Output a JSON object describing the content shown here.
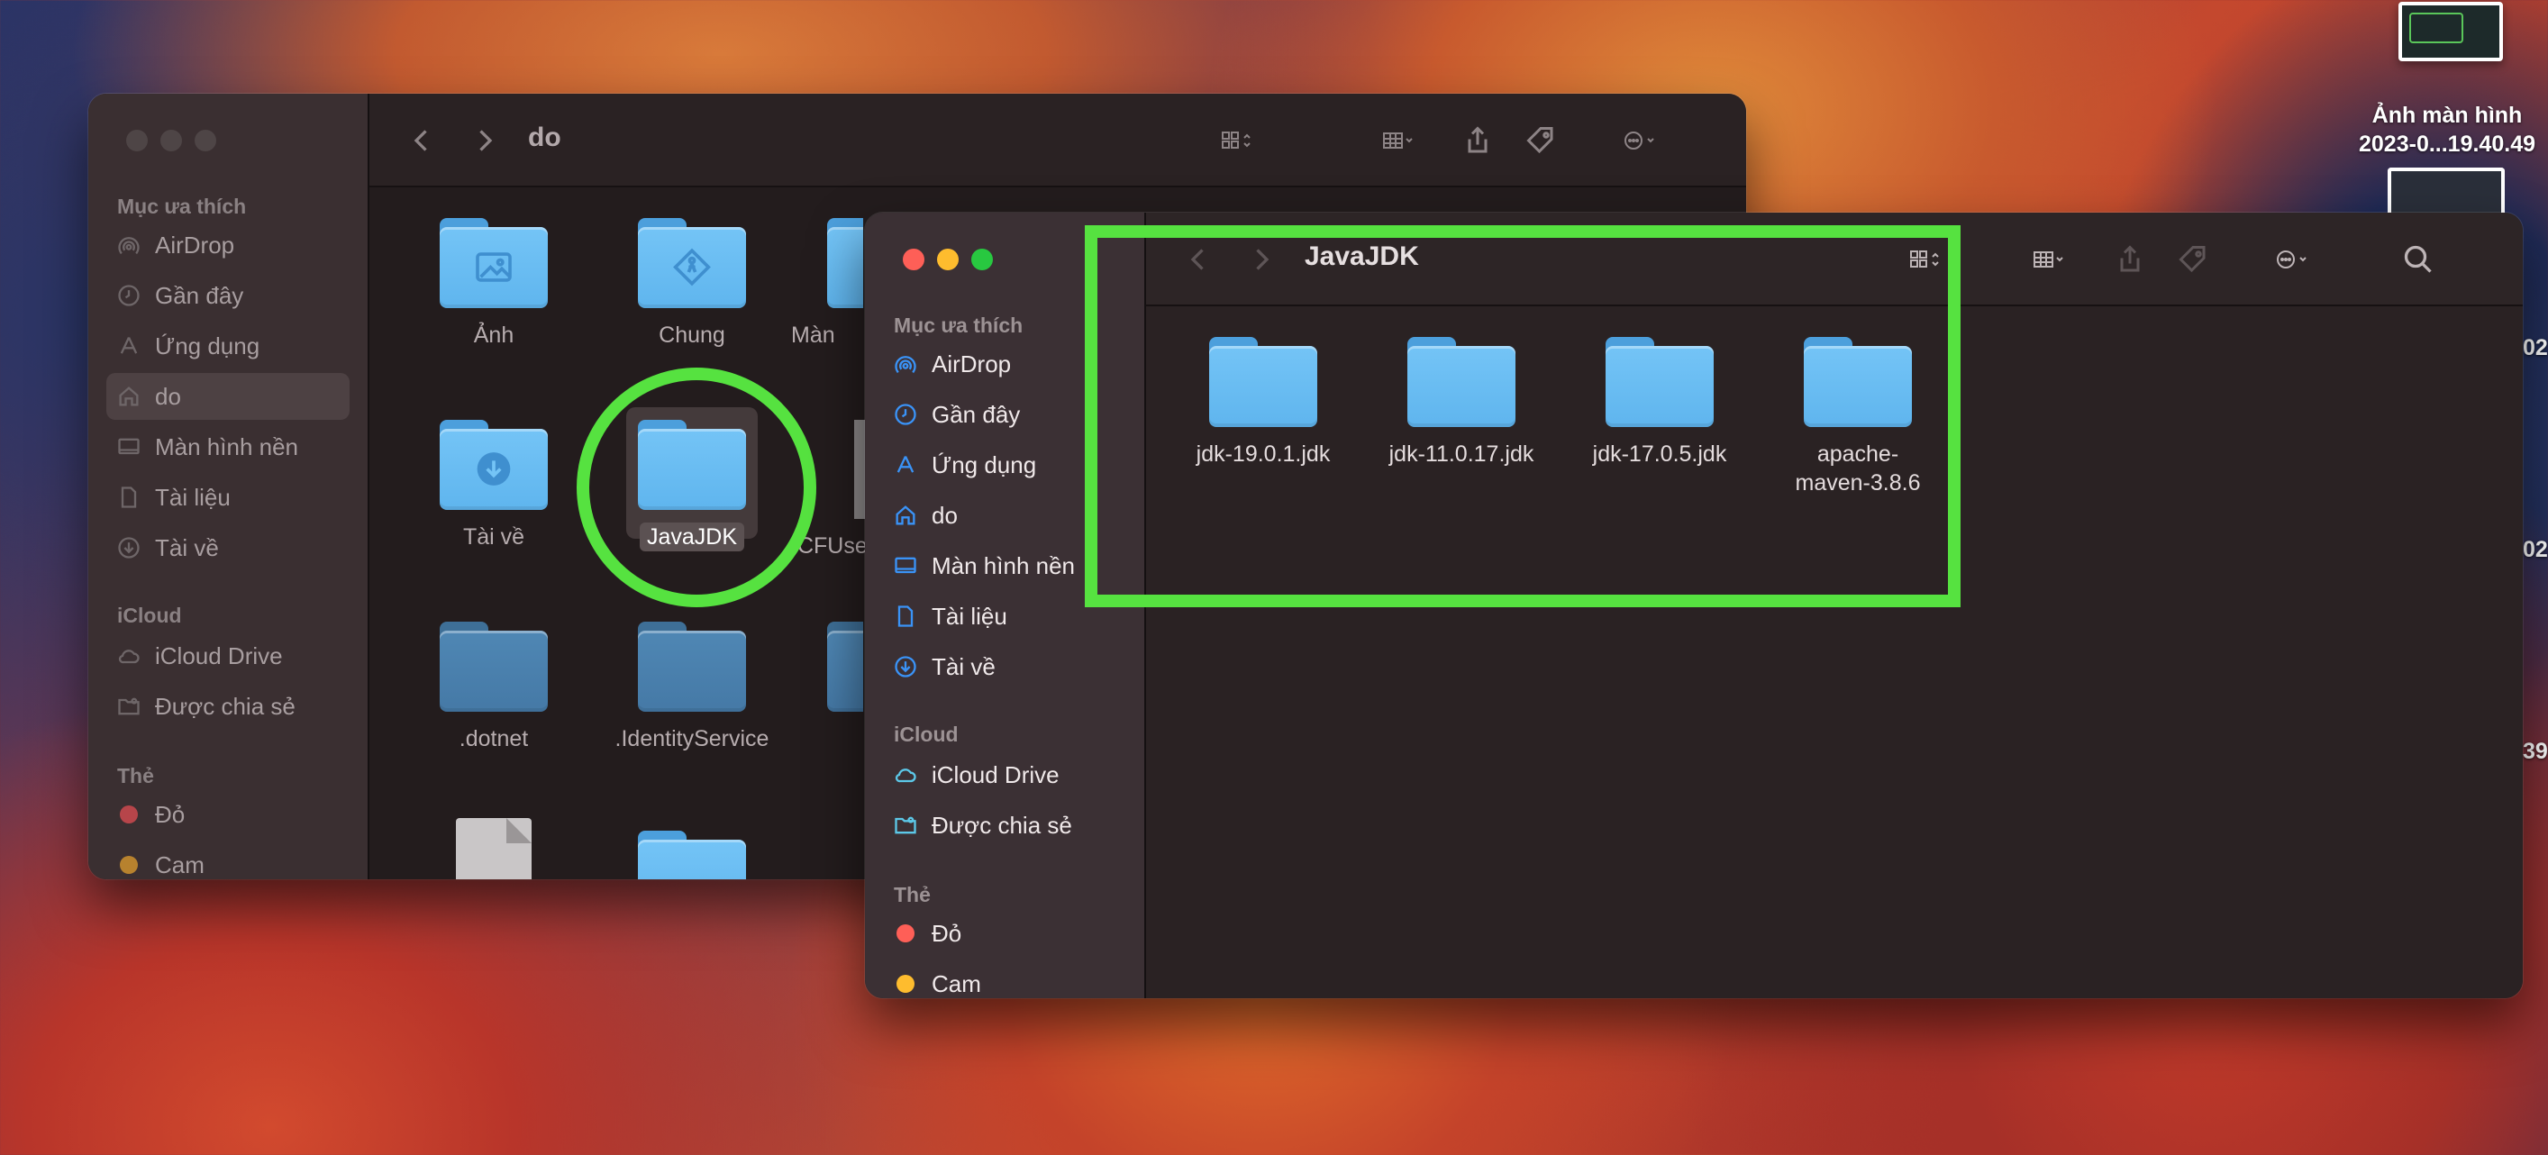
{
  "desktop": {
    "screenshot_label_line1": "Ảnh màn hình",
    "screenshot_label_line2": "2023-0...19.40.49",
    "edge_labels": [
      "02",
      "02",
      "39"
    ]
  },
  "back_window": {
    "title": "do",
    "sidebar": {
      "favorites_header": "Mục ưa thích",
      "favorites": [
        {
          "label": "AirDrop",
          "icon": "airdrop-icon"
        },
        {
          "label": "Gần đây",
          "icon": "clock-icon"
        },
        {
          "label": "Ứng dụng",
          "icon": "apps-icon"
        },
        {
          "label": "do",
          "icon": "home-icon",
          "selected": true
        },
        {
          "label": "Màn hình nền",
          "icon": "desktop-icon"
        },
        {
          "label": "Tài liệu",
          "icon": "document-icon"
        },
        {
          "label": "Tài về",
          "icon": "download-icon"
        }
      ],
      "icloud_header": "iCloud",
      "icloud": [
        {
          "label": "iCloud Drive",
          "icon": "cloud-icon"
        },
        {
          "label": "Được chia sẻ",
          "icon": "shared-folder-icon"
        }
      ],
      "tags_header": "Thẻ",
      "tags": [
        {
          "label": "Đỏ",
          "color": "#b7454a"
        },
        {
          "label": "Cam",
          "color": "#b7822e"
        }
      ]
    },
    "files": [
      {
        "name": "Ảnh"
      },
      {
        "name": "Chung"
      },
      {
        "name": "Màn"
      },
      {
        "name": "Tài về"
      },
      {
        "name": "JavaJDK"
      },
      {
        "name": ".CFUse"
      },
      {
        "name": ".dotnet"
      },
      {
        "name": ".IdentityService"
      },
      {
        "name": ""
      }
    ]
  },
  "front_window": {
    "title": "JavaJDK",
    "sidebar": {
      "favorites_header": "Mục ưa thích",
      "favorites": [
        {
          "label": "AirDrop",
          "icon": "airdrop-icon"
        },
        {
          "label": "Gần đây",
          "icon": "clock-icon"
        },
        {
          "label": "Ứng dụng",
          "icon": "apps-icon"
        },
        {
          "label": "do",
          "icon": "home-icon"
        },
        {
          "label": "Màn hình nền",
          "icon": "desktop-icon"
        },
        {
          "label": "Tài liệu",
          "icon": "document-icon"
        },
        {
          "label": "Tài về",
          "icon": "download-icon"
        }
      ],
      "icloud_header": "iCloud",
      "icloud": [
        {
          "label": "iCloud Drive",
          "icon": "cloud-icon"
        },
        {
          "label": "Được chia sẻ",
          "icon": "shared-folder-icon"
        }
      ],
      "tags_header": "Thẻ",
      "tags": [
        {
          "label": "Đỏ",
          "color": "#fe5f57"
        },
        {
          "label": "Cam",
          "color": "#febc2e"
        }
      ]
    },
    "files": [
      {
        "name": "jdk-19.0.1.jdk"
      },
      {
        "name": "jdk-11.0.17.jdk"
      },
      {
        "name": "jdk-17.0.5.jdk"
      },
      {
        "name_line1": "apache-",
        "name_line2": "maven-3.8.6"
      }
    ]
  },
  "colors": {
    "highlight": "#56e240",
    "folder": "#5fb5ee"
  }
}
